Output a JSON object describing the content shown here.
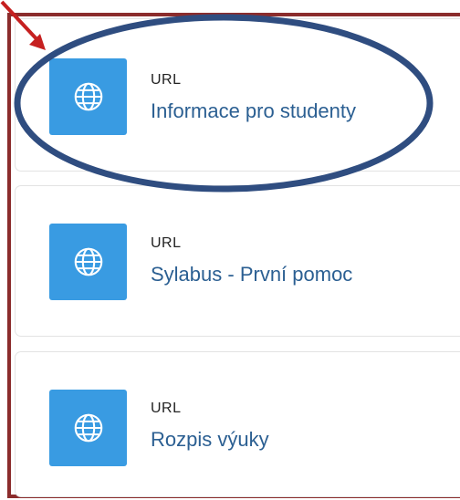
{
  "accent_color": "#399be2",
  "link_color": "#2b5f92",
  "frame_color": "#8b2c2c",
  "annotation_color": "#2f4d80",
  "arrow_color": "#c62020",
  "activities": [
    {
      "type": "URL",
      "title": "Informace pro studenty",
      "icon": "globe-icon"
    },
    {
      "type": "URL",
      "title": "Sylabus - První pomoc",
      "icon": "globe-icon"
    },
    {
      "type": "URL",
      "title": "Rozpis výuky",
      "icon": "globe-icon"
    }
  ]
}
